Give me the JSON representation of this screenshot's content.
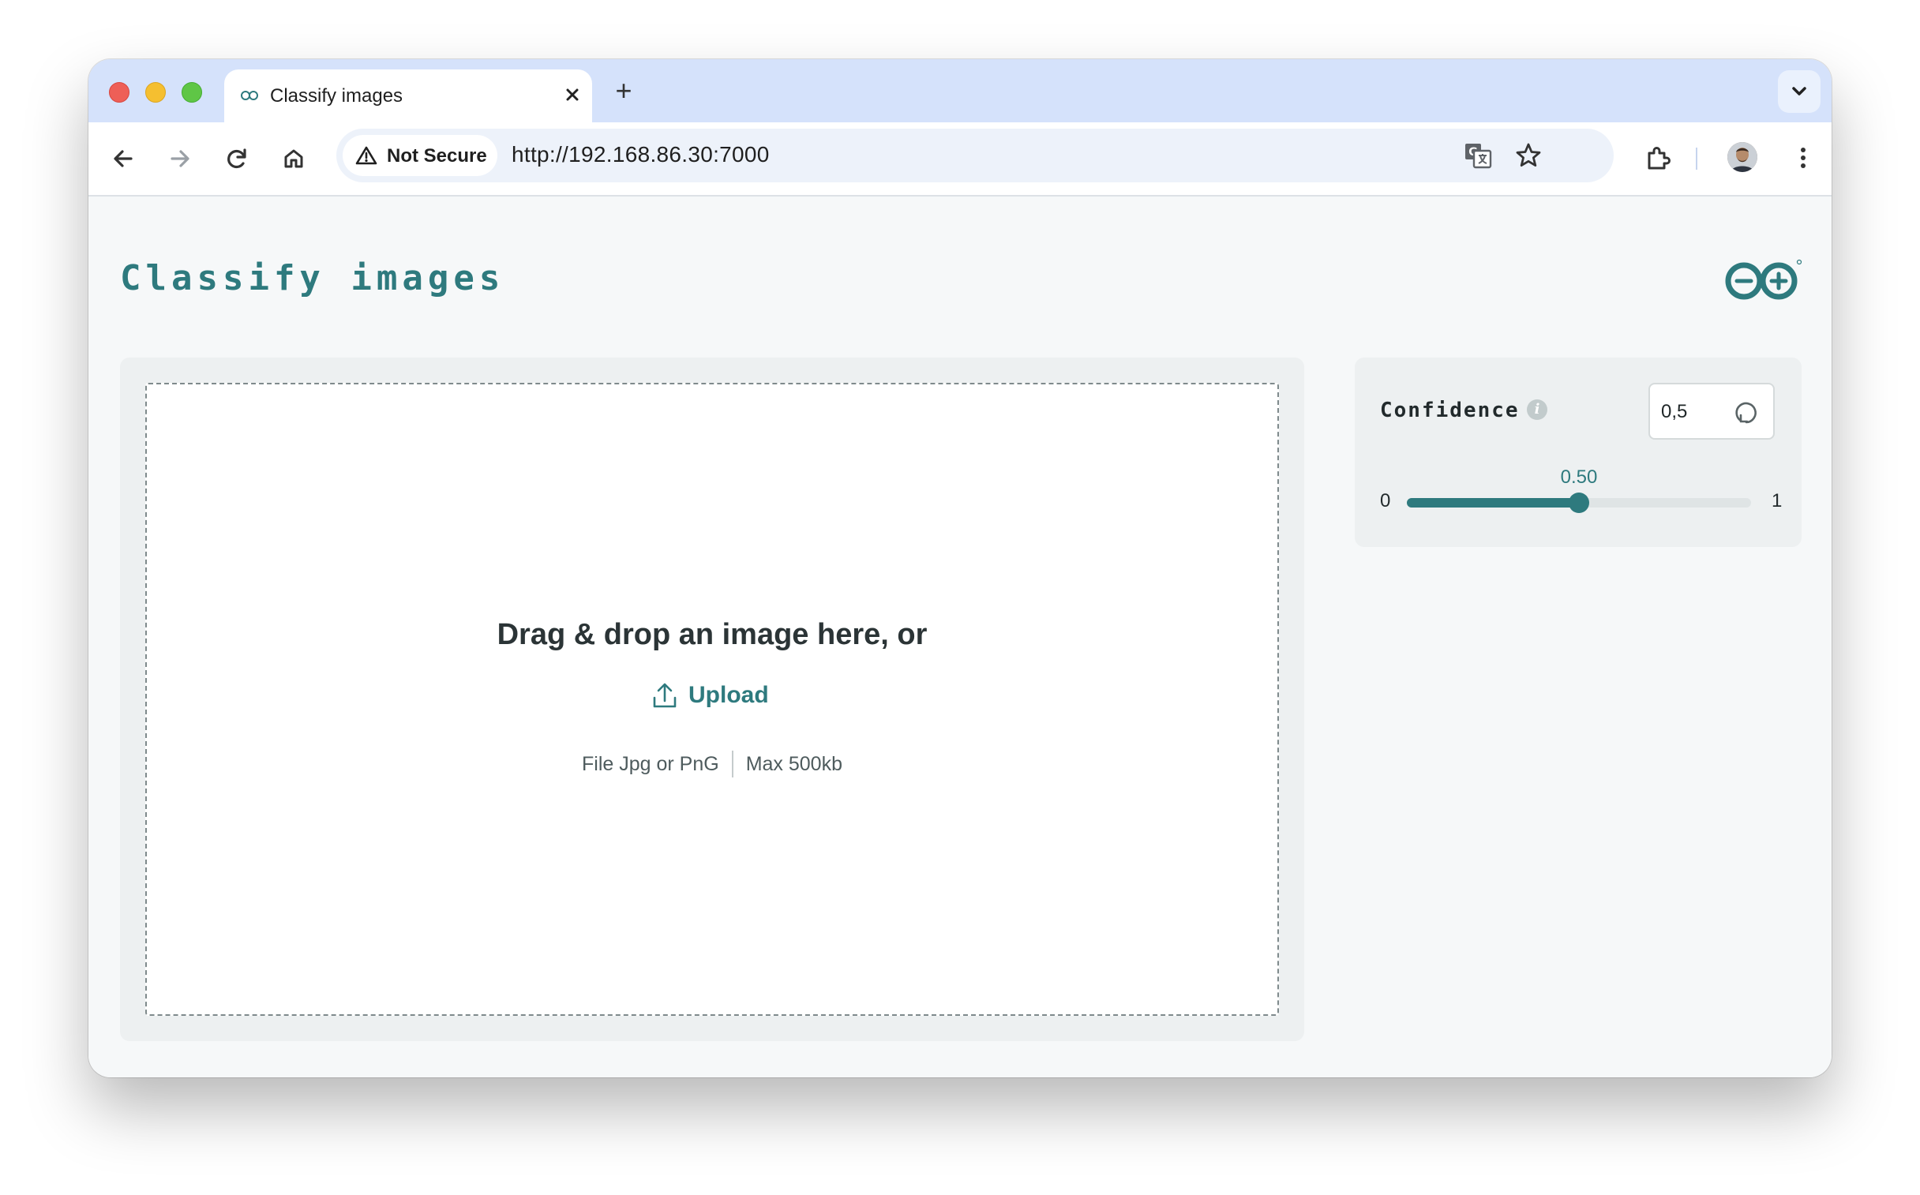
{
  "browser": {
    "tab_title": "Classify images",
    "new_tab_label": "+",
    "security_chip": "Not Secure",
    "url": "http://192.168.86.30:7000"
  },
  "page": {
    "title": "Classify images",
    "dropzone": {
      "title": "Drag & drop an image here, or",
      "upload_label": "Upload",
      "file_types": "File Jpg or PnG",
      "max_size": "Max 500kb"
    },
    "confidence": {
      "label": "Confidence",
      "info_glyph": "i",
      "input_value": "0,5",
      "slider_min": "0",
      "slider_max": "1",
      "slider_value_label": "0.50",
      "slider_value": 0.5
    }
  },
  "icons": [
    "tab-favicon-icon",
    "close-icon",
    "chevron-down-icon",
    "back-icon",
    "forward-icon",
    "reload-icon",
    "home-icon",
    "warning-icon",
    "translate-icon",
    "star-icon",
    "extensions-icon",
    "kebab-menu-icon",
    "arduino-logo",
    "upload-icon",
    "info-icon",
    "reset-icon"
  ],
  "colors": {
    "accent": "#2e7a7e",
    "tab_strip": "#d5e2fb",
    "page_bg": "#f6f8f9",
    "panel_bg": "#edf0f1"
  }
}
